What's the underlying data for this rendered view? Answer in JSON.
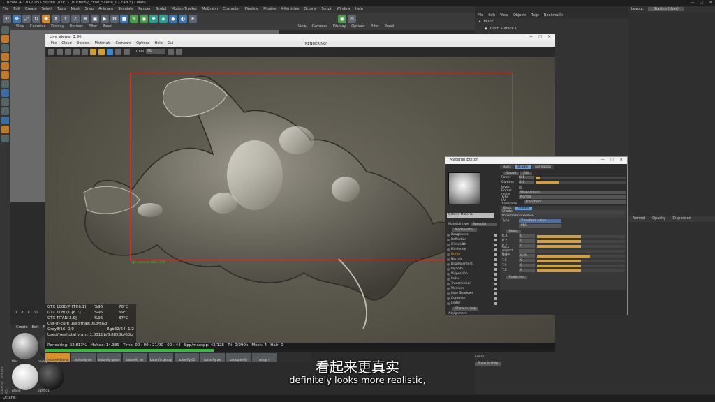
{
  "window": {
    "title": "CINEMA 4D R17.055 Studio (RTE) - [Butterfly_Final_Scene_02.c4d *] - Main",
    "layout_label": "Layout:",
    "layout_value": "Startup (User)"
  },
  "menubar": [
    "File",
    "Edit",
    "Create",
    "Select",
    "Tools",
    "Mesh",
    "Snap",
    "Animate",
    "Simulate",
    "Render",
    "Sculpt",
    "Motion Tracker",
    "MoGraph",
    "Character",
    "Pipeline",
    "Plugins",
    "X-Particles",
    "Octane",
    "Script",
    "Window",
    "Help"
  ],
  "viewport_menu": [
    "View",
    "Cameras",
    "Display",
    "Options",
    "Filter",
    "Panel"
  ],
  "viewport2_menu": [
    "View",
    "Cameras",
    "Display",
    "Options",
    "Filter",
    "Panel"
  ],
  "objects_menu": [
    "File",
    "Edit",
    "View",
    "Objects",
    "Tags",
    "Bookmarks"
  ],
  "objects": [
    {
      "name": "BODY"
    },
    {
      "name": "Cloth Surface.1"
    }
  ],
  "live_viewer": {
    "title": "Live Viewer 3.06",
    "menu": [
      "File",
      "Cloud",
      "Objects",
      "Materials",
      "Compare",
      "Options",
      "Help",
      "Gui"
    ],
    "center_label": "[RENDERING]",
    "channel_label": "Chnl",
    "channel_value": "DL",
    "region_label": "rgn-reserve 425 / 272",
    "stats": {
      "gpus": [
        {
          "name": "GTX 1080(P)[T][6.1]",
          "load": "%96",
          "temp": "78°C"
        },
        {
          "name": "GTX 1080(T)[6.1]",
          "load": "%95",
          "temp": "69°C"
        },
        {
          "name": "GTX TITAN[3.5]",
          "load": "%96",
          "temp": "87°C"
        }
      ],
      "out_of_core": "Out-of-core used/max:0Kb/6Gb",
      "grey_label": "Grey8/16: 0/0",
      "rgb_label": "Rgb32/64: 1/2",
      "vram": "Used/free/total vram: 1.031Gb/3.885Gb/6Gb"
    },
    "render_bar": {
      "rendering": "Rendering: 32.813%",
      "ms_sec": "Ms/sec: 14.339",
      "time": "Time: 00 : 00 : 21/00 : 00 : 44",
      "spp": "Spp/maxspp: 42/128",
      "tri": "Tri: 0/990k",
      "mesh": "Mesh: 4",
      "hair": "Hair: 0"
    },
    "progress": 0.33
  },
  "material_editor": {
    "title": "Material Editor",
    "material_name": "Octane Material",
    "material_type_label": "Material type",
    "material_type_value": "Specular",
    "node_editor_label": "Node Editor",
    "channels": [
      {
        "label": "Roughness",
        "active": false
      },
      {
        "label": "Reflection",
        "active": false
      },
      {
        "label": "Filmwidth",
        "active": false
      },
      {
        "label": "Filmindex",
        "active": false
      },
      {
        "label": "Bump",
        "active": true
      },
      {
        "label": "Normal",
        "active": false
      },
      {
        "label": "Displacement",
        "active": false
      },
      {
        "label": "Opacity",
        "active": false
      },
      {
        "label": "Dispersion",
        "active": false
      },
      {
        "label": "Index",
        "active": false
      },
      {
        "label": "Transmission",
        "active": false
      },
      {
        "label": "Medium",
        "active": false
      },
      {
        "label": "Fake Shadows",
        "active": false
      },
      {
        "label": "Common",
        "active": false
      },
      {
        "label": "Editor",
        "active": false
      }
    ],
    "show_in_help": "Show in Help",
    "assignment": "Assignment",
    "tabs": [
      "Basic",
      "Shader",
      "Animation"
    ],
    "active_tab": "Shader",
    "reload_label": "Reload",
    "edit_label": "Edit",
    "params": [
      {
        "label": "Power",
        "value": "0.1",
        "level": 0.05
      },
      {
        "label": "Gamma",
        "value": "2.2",
        "level": 0.25
      }
    ],
    "invert_label": "Invert",
    "border_mode_label": "Border mode",
    "border_mode_value": "Wrap around",
    "type_label": "Type",
    "type_value": "Normal",
    "uv_transform_label": "UV Transform",
    "uv_transform_value": "Transform",
    "sub_tabs": [
      "Basic",
      "Shader"
    ],
    "shader_label": "Shader",
    "uvw_label": "UVW transformation",
    "transform_type_label": "Type",
    "transform_type_value": "Transform value",
    "transform_mode_value": "PRS",
    "reset_label": "Reset",
    "transform_params": [
      {
        "label": "R.X",
        "value": "0",
        "level": 0.5
      },
      {
        "label": "R.Y",
        "value": "0",
        "level": 0.5
      },
      {
        "label": "R.Z",
        "value": "0",
        "level": 0.5
      },
      {
        "label": "Lock Aspect Ratio",
        "value": "",
        "level": 0
      },
      {
        "label": "S.X",
        "value": "0.25",
        "level": 0.6
      },
      {
        "label": "T.X",
        "value": "0",
        "level": 0.5
      },
      {
        "label": "T.Y",
        "value": "0",
        "level": 0.5
      },
      {
        "label": "T.Z",
        "value": "0",
        "level": 0.5
      }
    ],
    "projection_label": "Projection"
  },
  "attributes": {
    "tabs": [
      "Normal",
      "Opacity",
      "Dispersion"
    ],
    "left_list": [
      "Common",
      "Editor"
    ],
    "show_in_help": "Show in Help"
  },
  "material_manager": {
    "menu": [
      "Create",
      "Edit",
      "Fun"
    ],
    "materials": [
      "Mat",
      "background pas",
      "plane",
      "light 01"
    ],
    "strip": [
      "Octane Material",
      "butterfly sec",
      "butterfly glossy",
      "butterfly wir",
      "butterfly glossy",
      "butterfly 01",
      "butterfly wir",
      "bas butterfly",
      "wings !"
    ],
    "selected_index": 0
  },
  "subtitle": {
    "zh": "看起来更真实",
    "en": "definitely looks more realistic,"
  },
  "status_bar": "Octane:",
  "side_watermark": "MAXON CINEMA 4D"
}
